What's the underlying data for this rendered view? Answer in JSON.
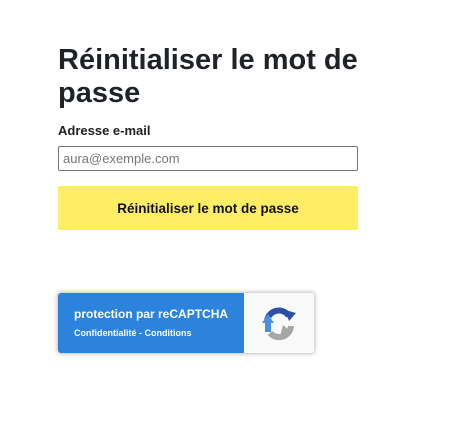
{
  "form": {
    "title": "Réinitialiser le mot de passe",
    "email_label": "Adresse e-mail",
    "email_placeholder": "aura@exemple.com",
    "email_value": "",
    "submit_label": "Réinitialiser le mot de passe"
  },
  "recaptcha": {
    "title_prefix": "protection par ",
    "title_brand": "reCAPTCHA",
    "privacy_link": "Confidentialité",
    "separator": " - ",
    "terms_link": "Conditions",
    "logo_icon": "recaptcha-logo-icon"
  },
  "colors": {
    "submit_button_bg": "#ffed66",
    "recaptcha_badge_bg": "#2b83dc",
    "title_text": "#1f2328"
  }
}
